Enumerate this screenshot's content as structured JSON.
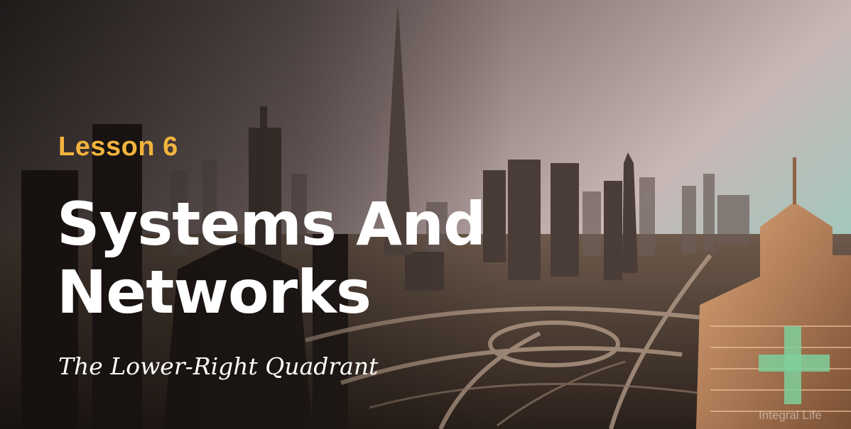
{
  "slide": {
    "lesson_label": "Lesson 6",
    "title_line1": "Systems And",
    "title_line2": "Networks",
    "subtitle": "The Lower-Right Quadrant",
    "brand_name": "Integral Life"
  },
  "colors": {
    "lesson_accent": "#f2b33d",
    "title_text": "#ffffff",
    "logo_green": "#7fcf9c"
  },
  "icons": {
    "logo": "plus-cross-icon"
  }
}
